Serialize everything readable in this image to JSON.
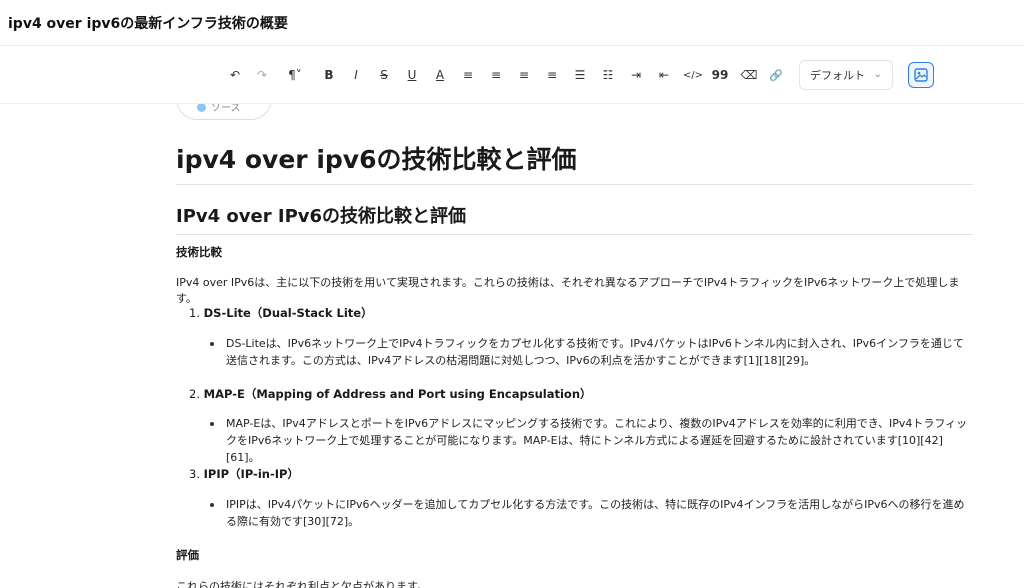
{
  "window": {
    "doc_title": "ipv4 over ipv6の最新インフラ技術の概要"
  },
  "toolbar": {
    "undo": "↶",
    "redo": "↷",
    "paragraph": "¶˅",
    "bold": "B",
    "italic": "I",
    "strike": "S",
    "underline": "U",
    "text_color": "A",
    "align_left": "≡",
    "align_center": "≡",
    "align_right": "≡",
    "align_justify": "≡",
    "bullet_list": "☰",
    "ordered_list": "☷",
    "indent": "⇥",
    "outdent": "⇤",
    "code": "</>",
    "quote": "99",
    "clear_format": "⌫",
    "link": "🔗",
    "style_value": "デフォルト",
    "icons": [
      "undo-icon",
      "redo-icon",
      "paragraph-icon",
      "bold-icon",
      "italic-icon",
      "strike-icon",
      "underline-icon",
      "text-color-icon",
      "align-left-icon",
      "align-center-icon",
      "align-right-icon",
      "align-justify-icon",
      "bullet-list-icon",
      "ordered-list-icon",
      "indent-icon",
      "outdent-icon",
      "code-icon",
      "quote-icon",
      "clear-format-icon",
      "link-icon",
      "image-icon"
    ]
  },
  "chip": {
    "label": "ソース"
  },
  "doc": {
    "h1": "ipv4 over ipv6の技術比較と評価",
    "h2": "IPv4 over IPv6の技術比較と評価",
    "section1": "技術比較",
    "intro": "IPv4 over IPv6は、主に以下の技術を用いて実現されます。これらの技術は、それぞれ異なるアプローチでIPv4トラフィックをIPv6ネットワーク上で処理します。",
    "items": [
      {
        "num": "1.",
        "name": "DS-Lite（Dual-Stack Lite）",
        "text": "DS-Liteは、IPv6ネットワーク上でIPv4トラフィックをカプセル化する技術です。IPv4パケットはIPv6トンネル内に封入され、IPv6インフラを通じて送信されます。この方式は、IPv4アドレスの枯渇問題に対処しつつ、IPv6の利点を活かすことができます[1][18][29]。"
      },
      {
        "num": "2.",
        "name": "MAP-E（Mapping of Address and Port using Encapsulation）",
        "text": "MAP-Eは、IPv4アドレスとポートをIPv6アドレスにマッピングする技術です。これにより、複数のIPv4アドレスを効率的に利用でき、IPv4トラフィックをIPv6ネットワーク上で処理することが可能になります。MAP-Eは、特にトンネル方式による遅延を回避するために設計されています[10][42][61]。"
      },
      {
        "num": "3.",
        "name": "IPIP（IP-in-IP）",
        "text": "IPIPは、IPv4パケットにIPv6ヘッダーを追加してカプセル化する方法です。この技術は、特に既存のIPv4インフラを活用しながらIPv6への移行を進める際に有効です[30][72]。"
      }
    ],
    "section2": "評価",
    "section2_intro": "これらの技術にはそれぞれ利点と欠点があります。"
  },
  "colors": {
    "accent": "#2f80ed",
    "border": "#e4e4e4"
  }
}
